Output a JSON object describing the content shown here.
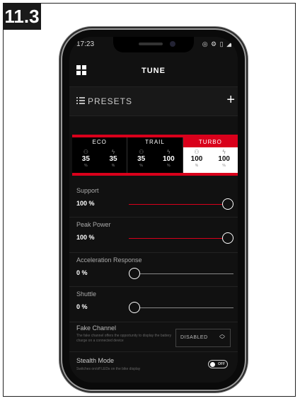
{
  "figure": {
    "step": "11.3"
  },
  "status_bar": {
    "time": "17:23",
    "icons": "◎ ⚙ ▯ ◢"
  },
  "header": {
    "title": "TUNE",
    "menu_icon": "grid-icon"
  },
  "presets": {
    "label": "PRESETS",
    "add": "+"
  },
  "modes": [
    {
      "name": "ECO",
      "support": "35",
      "power": "35",
      "unit": "%",
      "active": false
    },
    {
      "name": "TRAIL",
      "support": "35",
      "power": "100",
      "unit": "%",
      "active": false
    },
    {
      "name": "TURBO",
      "support": "100",
      "power": "100",
      "unit": "%",
      "active": true
    }
  ],
  "settings": {
    "support": {
      "label": "Support",
      "value": "100 %",
      "level": 1.0
    },
    "peak_power": {
      "label": "Peak Power",
      "value": "100 %",
      "level": 1.0
    },
    "acceleration": {
      "label": "Acceleration Response",
      "value": "0 %",
      "level": 0.0
    },
    "shuttle": {
      "label": "Shuttle",
      "value": "0 %",
      "level": 0.0
    },
    "fake_channel": {
      "label": "Fake Channel",
      "description": "The fake channel offers the opportunity to display the battery charge on a connected device",
      "selected": "DISABLED"
    },
    "stealth_mode": {
      "label": "Stealth Mode",
      "description": "Switches on/off LEDs on the bike display",
      "state": "OFF"
    }
  },
  "colors": {
    "accent": "#d9001b",
    "background": "#111111"
  }
}
